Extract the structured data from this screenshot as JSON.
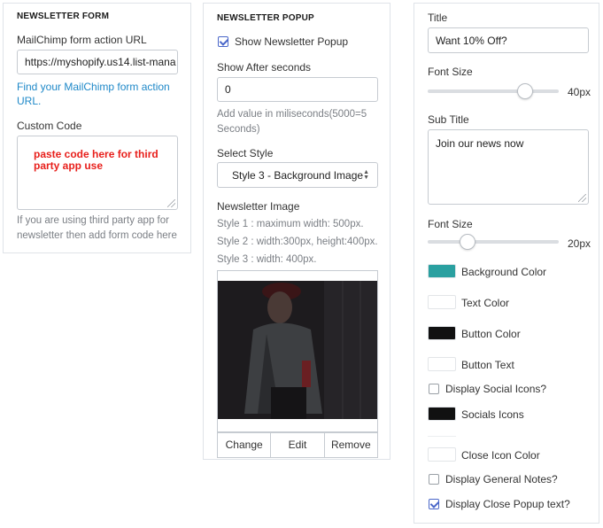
{
  "newsletter_form": {
    "title": "NEWSLETTER FORM",
    "action_url_label": "MailChimp form action URL",
    "action_url_value": "https://myshopify.us14.list-mana",
    "find_link": "Find your MailChimp form action URL.",
    "custom_code_label": "Custom Code",
    "custom_code_value": "paste code here for third party app use",
    "help_text": "If you are using third party app for newsletter then add form code here"
  },
  "newsletter_popup": {
    "title": "NEWSLETTER POPUP",
    "show_popup_label": "Show Newsletter Popup",
    "show_popup_checked": true,
    "show_after_label": "Show After seconds",
    "show_after_value": "0",
    "show_after_help": "Add value in miliseconds(5000=5 Seconds)",
    "select_style_label": "Select Style",
    "select_style_value": "Style 3 - Background Image",
    "image_label": "Newsletter Image",
    "style_notes": [
      "Style 1 : maximum width: 500px.",
      "Style 2 : width:300px, height:400px.",
      "Style 3 : width: 400px."
    ],
    "buttons": {
      "change": "Change",
      "edit": "Edit",
      "remove": "Remove"
    }
  },
  "popup_settings": {
    "title_label": "Title",
    "title_value": "Want 10% Off?",
    "font_size_label": "Font Size",
    "font_size_value": "40px",
    "font_size_fraction": 0.78,
    "subtitle_label": "Sub Title",
    "subtitle_value": "Join our news now",
    "font_size2_label": "Font Size",
    "font_size2_value": "20px",
    "font_size2_fraction": 0.28,
    "colors": {
      "background": {
        "label": "Background Color",
        "hex": "#2aa0a0"
      },
      "text": {
        "label": "Text Color",
        "hex": "#ffffff"
      },
      "button": {
        "label": "Button Color",
        "hex": "#111111"
      },
      "button_text": {
        "label": "Button Text",
        "hex": "#ffffff"
      },
      "socials": {
        "label": "Socials Icons",
        "hex": "#111111"
      },
      "close_icon": {
        "label": "Close Icon Color",
        "hex": "#ffffff"
      }
    },
    "display_social_label": "Display Social Icons?",
    "display_social_checked": false,
    "display_notes_label": "Display General Notes?",
    "display_notes_checked": false,
    "display_close_label": "Display Close Popup text?",
    "display_close_checked": true
  }
}
